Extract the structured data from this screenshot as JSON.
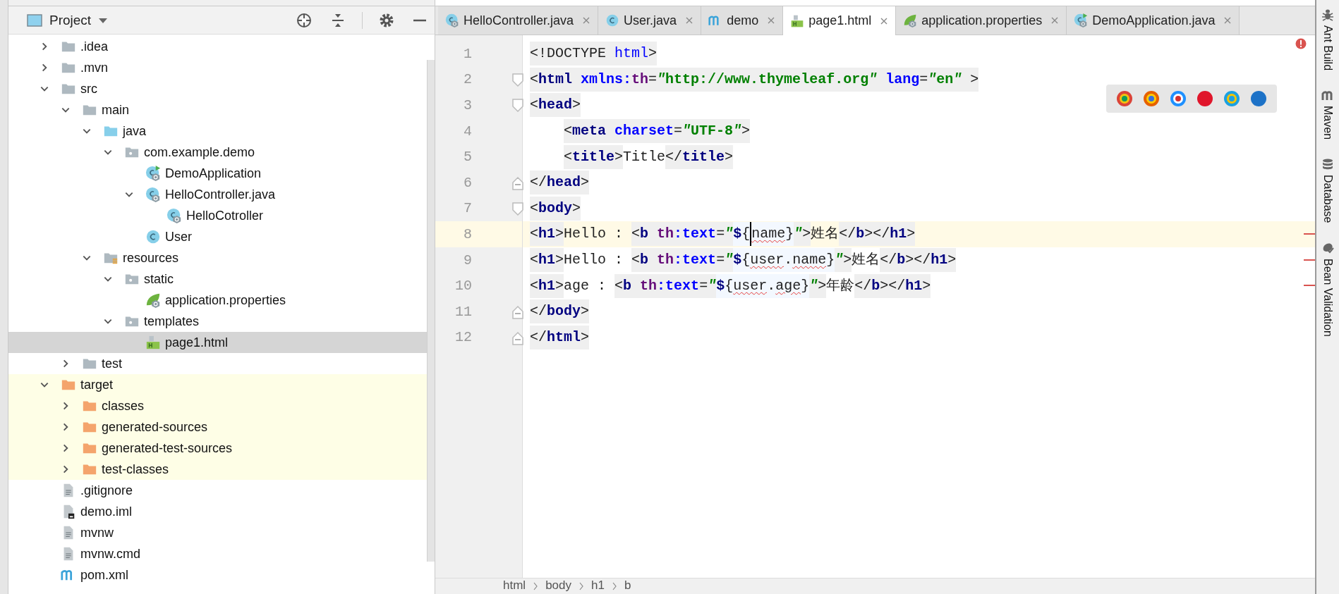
{
  "project_panel": {
    "title": "Project",
    "tree": [
      {
        "label": ".idea",
        "kind": "folder",
        "expanded": false,
        "selected": false,
        "excluded": false
      },
      {
        "label": ".mvn",
        "kind": "folder",
        "expanded": false,
        "selected": false,
        "excluded": false
      },
      {
        "label": "src",
        "kind": "folder",
        "expanded": true,
        "selected": false,
        "excluded": false,
        "children": [
          {
            "label": "main",
            "kind": "folder",
            "expanded": true,
            "selected": false,
            "excluded": false,
            "children": [
              {
                "label": "java",
                "kind": "source-folder",
                "expanded": true,
                "selected": false,
                "excluded": false,
                "children": [
                  {
                    "label": "com.example.demo",
                    "kind": "package",
                    "expanded": true,
                    "selected": false,
                    "excluded": false,
                    "children": [
                      {
                        "label": "DemoApplication",
                        "kind": "spring-run-class",
                        "selected": false,
                        "excluded": false
                      },
                      {
                        "label": "HelloController.java",
                        "kind": "spring-class",
                        "expanded": true,
                        "selected": false,
                        "excluded": false,
                        "children": [
                          {
                            "label": "HelloCotroller",
                            "kind": "spring-class",
                            "selected": false,
                            "excluded": false
                          }
                        ]
                      },
                      {
                        "label": "User",
                        "kind": "class",
                        "selected": false,
                        "excluded": false
                      }
                    ]
                  }
                ]
              },
              {
                "label": "resources",
                "kind": "resources-folder",
                "expanded": true,
                "selected": false,
                "excluded": false,
                "children": [
                  {
                    "label": "static",
                    "kind": "package",
                    "expanded": true,
                    "selected": false,
                    "excluded": false,
                    "children": [
                      {
                        "label": "application.properties",
                        "kind": "spring-file",
                        "selected": false,
                        "excluded": false
                      }
                    ]
                  },
                  {
                    "label": "templates",
                    "kind": "package",
                    "expanded": true,
                    "selected": false,
                    "excluded": false,
                    "children": [
                      {
                        "label": "page1.html",
                        "kind": "html-file",
                        "selected": true,
                        "excluded": false
                      }
                    ]
                  }
                ]
              }
            ]
          },
          {
            "label": "test",
            "kind": "folder",
            "expanded": false,
            "selected": false,
            "excluded": false
          }
        ]
      },
      {
        "label": "target",
        "kind": "excluded-folder",
        "expanded": true,
        "selected": false,
        "excluded": true,
        "children": [
          {
            "label": "classes",
            "kind": "excluded-folder",
            "expanded": false,
            "selected": false,
            "excluded": true
          },
          {
            "label": "generated-sources",
            "kind": "excluded-folder",
            "expanded": false,
            "selected": false,
            "excluded": true
          },
          {
            "label": "generated-test-sources",
            "kind": "excluded-folder",
            "expanded": false,
            "selected": false,
            "excluded": true
          },
          {
            "label": "test-classes",
            "kind": "excluded-folder",
            "expanded": false,
            "selected": false,
            "excluded": true
          }
        ]
      },
      {
        "label": ".gitignore",
        "kind": "text-file",
        "selected": false,
        "excluded": false
      },
      {
        "label": "demo.iml",
        "kind": "module-file",
        "selected": false,
        "excluded": false
      },
      {
        "label": "mvnw",
        "kind": "text-file",
        "selected": false,
        "excluded": false
      },
      {
        "label": "mvnw.cmd",
        "kind": "text-file",
        "selected": false,
        "excluded": false
      },
      {
        "label": "pom.xml",
        "kind": "maven-file",
        "selected": false,
        "excluded": false
      }
    ]
  },
  "editor": {
    "tabs": [
      {
        "label": "HelloController.java",
        "kind": "spring-class",
        "selected": false
      },
      {
        "label": "User.java",
        "kind": "class",
        "selected": false
      },
      {
        "label": "demo",
        "kind": "maven-file",
        "selected": false
      },
      {
        "label": "page1.html",
        "kind": "html-file",
        "selected": true
      },
      {
        "label": "application.properties",
        "kind": "spring-file",
        "selected": false
      },
      {
        "label": "DemoApplication.java",
        "kind": "spring-run-class",
        "selected": false
      }
    ],
    "lines": [
      {
        "number": "1",
        "kind": "plain",
        "indented": false,
        "current": false,
        "error": false,
        "tokens": [
          {
            "text": "<!DOCTYPE ",
            "kind": "punct"
          },
          {
            "text": "html",
            "kind": "keyword"
          },
          {
            "text": ">",
            "kind": "punct"
          }
        ]
      },
      {
        "number": "2",
        "kind": "fold-start",
        "indented": false,
        "current": false,
        "error": false,
        "tokens": [
          {
            "text": "<",
            "kind": "punct"
          },
          {
            "text": "html",
            "kind": "tag"
          },
          {
            "text": " xmlns:",
            "kind": "attr"
          },
          {
            "text": "th",
            "kind": "ns"
          },
          {
            "text": "=",
            "kind": "punct"
          },
          {
            "text": "\"",
            "kind": "quote"
          },
          {
            "text": "http://www.thymeleaf.org",
            "kind": "value"
          },
          {
            "text": "\"",
            "kind": "quote"
          },
          {
            "text": " lang",
            "kind": "attr"
          },
          {
            "text": "=",
            "kind": "punct"
          },
          {
            "text": "\"",
            "kind": "quote"
          },
          {
            "text": "en",
            "kind": "value"
          },
          {
            "text": "\"",
            "kind": "quote"
          },
          {
            "text": " >",
            "kind": "punct"
          }
        ]
      },
      {
        "number": "3",
        "kind": "fold-start",
        "indented": false,
        "current": false,
        "error": false,
        "tokens": [
          {
            "text": "<",
            "kind": "punct"
          },
          {
            "text": "head",
            "kind": "tag"
          },
          {
            "text": ">",
            "kind": "punct"
          }
        ]
      },
      {
        "number": "4",
        "kind": "plain",
        "indented": true,
        "current": false,
        "error": false,
        "tokens": [
          {
            "text": "<",
            "kind": "punct"
          },
          {
            "text": "meta",
            "kind": "tag"
          },
          {
            "text": " charset",
            "kind": "attr"
          },
          {
            "text": "=",
            "kind": "punct"
          },
          {
            "text": "\"",
            "kind": "quote"
          },
          {
            "text": "UTF-8",
            "kind": "value"
          },
          {
            "text": "\"",
            "kind": "quote"
          },
          {
            "text": ">",
            "kind": "punct"
          }
        ]
      },
      {
        "number": "5",
        "kind": "plain",
        "indented": true,
        "current": false,
        "error": false,
        "tokens": [
          {
            "text": "<",
            "kind": "punct"
          },
          {
            "text": "title",
            "kind": "tag"
          },
          {
            "text": ">",
            "kind": "punct"
          },
          {
            "text": "Title",
            "kind": "text"
          },
          {
            "text": "</",
            "kind": "punct"
          },
          {
            "text": "title",
            "kind": "tag"
          },
          {
            "text": ">",
            "kind": "punct"
          }
        ]
      },
      {
        "number": "6",
        "kind": "fold-end",
        "indented": false,
        "current": false,
        "error": false,
        "tokens": [
          {
            "text": "</",
            "kind": "punct"
          },
          {
            "text": "head",
            "kind": "tag"
          },
          {
            "text": ">",
            "kind": "punct"
          }
        ]
      },
      {
        "number": "7",
        "kind": "fold-start",
        "indented": false,
        "current": false,
        "error": false,
        "tokens": [
          {
            "text": "<",
            "kind": "punct"
          },
          {
            "text": "body",
            "kind": "tag"
          },
          {
            "text": ">",
            "kind": "punct"
          }
        ]
      },
      {
        "number": "8",
        "kind": "plain",
        "indented": false,
        "current": true,
        "error": true,
        "tokens": [
          {
            "text": "<",
            "kind": "punct"
          },
          {
            "text": "h1",
            "kind": "tag"
          },
          {
            "text": ">",
            "kind": "punct"
          },
          {
            "text": "Hello : ",
            "kind": "text"
          },
          {
            "text": "<",
            "kind": "punct"
          },
          {
            "text": "b",
            "kind": "tag"
          },
          {
            "text": " th",
            "kind": "ns"
          },
          {
            "text": ":text",
            "kind": "attr"
          },
          {
            "text": "=",
            "kind": "punct"
          },
          {
            "text": "\"",
            "kind": "quote"
          },
          {
            "text": "$",
            "kind": "expr"
          },
          {
            "text": "{",
            "kind": "exprtext"
          },
          {
            "text": "name",
            "kind": "typo",
            "caret": true
          },
          {
            "text": "}",
            "kind": "exprtext"
          },
          {
            "text": "\"",
            "kind": "quote"
          },
          {
            "text": ">",
            "kind": "punct"
          },
          {
            "text": "姓名",
            "kind": "text"
          },
          {
            "text": "</",
            "kind": "punct"
          },
          {
            "text": "b",
            "kind": "tag"
          },
          {
            "text": "></",
            "kind": "punct"
          },
          {
            "text": "h1",
            "kind": "tag"
          },
          {
            "text": ">",
            "kind": "punct"
          }
        ]
      },
      {
        "number": "9",
        "kind": "plain",
        "indented": false,
        "current": false,
        "error": true,
        "tokens": [
          {
            "text": "<",
            "kind": "punct"
          },
          {
            "text": "h1",
            "kind": "tag"
          },
          {
            "text": ">",
            "kind": "punct"
          },
          {
            "text": "Hello : ",
            "kind": "text"
          },
          {
            "text": "<",
            "kind": "punct"
          },
          {
            "text": "b",
            "kind": "tag"
          },
          {
            "text": " th",
            "kind": "ns"
          },
          {
            "text": ":text",
            "kind": "attr"
          },
          {
            "text": "=",
            "kind": "punct"
          },
          {
            "text": "\"",
            "kind": "quote"
          },
          {
            "text": "$",
            "kind": "expr"
          },
          {
            "text": "{",
            "kind": "exprtext"
          },
          {
            "text": "user",
            "kind": "typo"
          },
          {
            "text": ".",
            "kind": "exprtext"
          },
          {
            "text": "name",
            "kind": "typo"
          },
          {
            "text": "}",
            "kind": "exprtext"
          },
          {
            "text": "\"",
            "kind": "quote"
          },
          {
            "text": ">",
            "kind": "punct"
          },
          {
            "text": "姓名",
            "kind": "text"
          },
          {
            "text": "</",
            "kind": "punct"
          },
          {
            "text": "b",
            "kind": "tag"
          },
          {
            "text": "></",
            "kind": "punct"
          },
          {
            "text": "h1",
            "kind": "tag"
          },
          {
            "text": ">",
            "kind": "punct"
          }
        ]
      },
      {
        "number": "10",
        "kind": "plain",
        "indented": false,
        "current": false,
        "error": true,
        "tokens": [
          {
            "text": "<",
            "kind": "punct"
          },
          {
            "text": "h1",
            "kind": "tag"
          },
          {
            "text": ">",
            "kind": "punct"
          },
          {
            "text": "age : ",
            "kind": "text"
          },
          {
            "text": "<",
            "kind": "punct"
          },
          {
            "text": "b",
            "kind": "tag"
          },
          {
            "text": " th",
            "kind": "ns"
          },
          {
            "text": ":text",
            "kind": "attr"
          },
          {
            "text": "=",
            "kind": "punct"
          },
          {
            "text": "\"",
            "kind": "quote"
          },
          {
            "text": "$",
            "kind": "expr"
          },
          {
            "text": "{",
            "kind": "exprtext"
          },
          {
            "text": "user",
            "kind": "typo"
          },
          {
            "text": ".",
            "kind": "exprtext"
          },
          {
            "text": "age",
            "kind": "typo"
          },
          {
            "text": "}",
            "kind": "exprtext"
          },
          {
            "text": "\"",
            "kind": "quote"
          },
          {
            "text": ">",
            "kind": "punct"
          },
          {
            "text": "年龄",
            "kind": "text"
          },
          {
            "text": "</",
            "kind": "punct"
          },
          {
            "text": "b",
            "kind": "tag"
          },
          {
            "text": "></",
            "kind": "punct"
          },
          {
            "text": "h1",
            "kind": "tag"
          },
          {
            "text": ">",
            "kind": "punct"
          }
        ]
      },
      {
        "number": "11",
        "kind": "fold-end",
        "indented": false,
        "current": false,
        "error": false,
        "tokens": [
          {
            "text": "</",
            "kind": "punct"
          },
          {
            "text": "body",
            "kind": "tag"
          },
          {
            "text": ">",
            "kind": "punct"
          }
        ]
      },
      {
        "number": "12",
        "kind": "fold-end",
        "indented": false,
        "current": false,
        "error": false,
        "tokens": [
          {
            "text": "</",
            "kind": "punct"
          },
          {
            "text": "html",
            "kind": "tag"
          },
          {
            "text": ">",
            "kind": "punct"
          }
        ]
      }
    ],
    "breadcrumb": [
      "html",
      "body",
      "h1",
      "b"
    ]
  },
  "right_toolbar": [
    {
      "label": "Ant Build",
      "kind": "ant"
    },
    {
      "label": "Maven",
      "kind": "maven"
    },
    {
      "label": "Database",
      "kind": "database"
    },
    {
      "label": "Bean Validation",
      "kind": "bean"
    }
  ]
}
